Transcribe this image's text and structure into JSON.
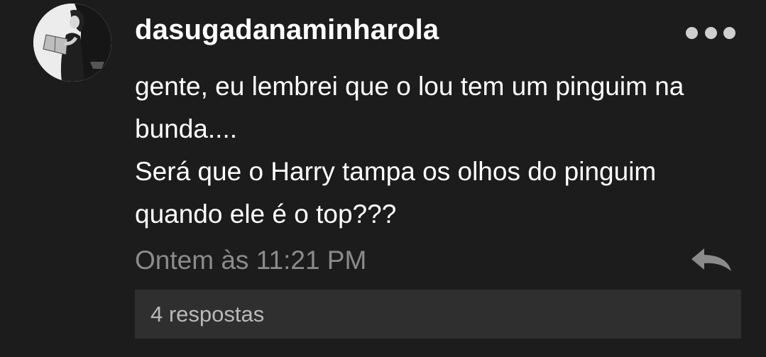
{
  "comment": {
    "username": "dasugadanaminharola",
    "text_lines": [
      "gente, eu lembrei que o lou tem um pinguim na",
      "bunda....",
      "Será que o Harry tampa os olhos do pinguim",
      "quando ele é o top???"
    ],
    "timestamp": "Ontem às 11:21 PM",
    "replies_label": "4 respostas"
  },
  "icons": {
    "avatar": "user-avatar-photo",
    "more": "more-options-dots-icon",
    "reply": "reply-arrow-icon"
  },
  "colors": {
    "background": "#1c1c1c",
    "text": "#ffffff",
    "muted_text": "#8b8b8b",
    "replies_bar": "#2f2f2f",
    "replies_text": "#b9b9b9",
    "icon": "#cfcfcf"
  }
}
